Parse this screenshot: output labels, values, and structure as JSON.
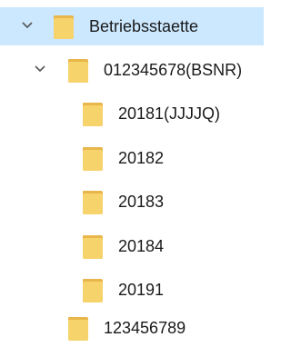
{
  "tree": {
    "root": {
      "label": "Betriebsstaette",
      "expanded": true,
      "selected": true,
      "icon": "folder-icon",
      "chevron": "chevron-down-icon"
    },
    "branch": {
      "label": "012345678(BSNR)",
      "expanded": true,
      "icon": "folder-icon",
      "chevron": "chevron-down-icon"
    },
    "leaves": [
      {
        "label": "20181(JJJJQ)",
        "icon": "folder-icon"
      },
      {
        "label": "20182",
        "icon": "folder-icon"
      },
      {
        "label": "20183",
        "icon": "folder-icon"
      },
      {
        "label": "20184",
        "icon": "folder-icon"
      },
      {
        "label": "20191",
        "icon": "folder-icon"
      }
    ],
    "sibling": {
      "label": "123456789",
      "icon": "folder-icon"
    }
  },
  "colors": {
    "selection": "#cce8ff",
    "folder_body": "#f7d36b",
    "folder_back": "#e8b64a",
    "chevron": "#555555"
  }
}
